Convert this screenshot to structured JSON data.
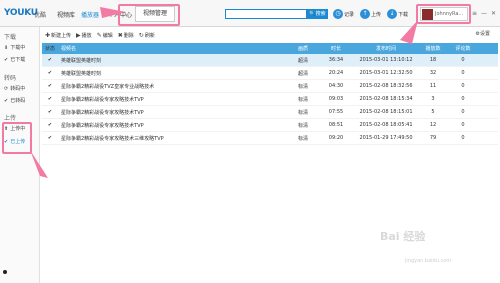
{
  "app": {
    "logo": "YOUKU",
    "logo_text": "优酷",
    "nav": [
      "视频库",
      "播放器",
      "个人中心",
      "视频管理"
    ],
    "active_nav": "视频管理",
    "search_placeholder": "",
    "search_button": "搜索",
    "actions": {
      "history": "记录",
      "upload": "上传",
      "download": "下载"
    },
    "user": "JohnnyRa...",
    "window_controls": {
      "menu": "≡",
      "minimize": "—",
      "close": "✕"
    }
  },
  "sidebar": {
    "groups": [
      {
        "label": "下载",
        "items": [
          {
            "label": "下载中",
            "icon": "down-arrow-icon"
          },
          {
            "label": "已下载",
            "icon": "check-icon"
          }
        ]
      },
      {
        "label": "转码",
        "items": [
          {
            "label": "转码中",
            "icon": "spinner-icon"
          },
          {
            "label": "已转码",
            "icon": "check-icon"
          }
        ]
      },
      {
        "label": "上传",
        "items": [
          {
            "label": "上传中",
            "icon": "up-arrow-icon"
          },
          {
            "label": "已上传",
            "icon": "check-icon",
            "selected": true
          }
        ]
      }
    ]
  },
  "toolbar": {
    "new_upload": "新建上传",
    "play": "播放",
    "edit": "编辑",
    "delete": "删除",
    "refresh": "刷新",
    "settings": "设置"
  },
  "table": {
    "headers": [
      "状态",
      "视频名",
      "画质",
      "时长",
      "发布时间",
      "播放数",
      "评论数"
    ],
    "rows": [
      {
        "status": "✔",
        "name": "英雄联盟英雄时刻",
        "quality": "超清",
        "duration": "36:34",
        "published": "2015-03-01 13:10:12",
        "plays": "18",
        "comments": "0",
        "selected": true
      },
      {
        "status": "✔",
        "name": "英雄联盟英雄时刻",
        "quality": "超清",
        "duration": "20:24",
        "published": "2015-03-01 12:32:50",
        "plays": "32",
        "comments": "0"
      },
      {
        "status": "✔",
        "name": "星际争霸2精彩战役TVZ皇家专业战略技术",
        "quality": "标清",
        "duration": "04:30",
        "published": "2015-02-08 18:32:56",
        "plays": "11",
        "comments": "0"
      },
      {
        "status": "✔",
        "name": "星际争霸2精彩战役专家攻略技术TVP",
        "quality": "标清",
        "duration": "09:03",
        "published": "2015-02-08 18:15:34",
        "plays": "3",
        "comments": "0"
      },
      {
        "status": "✔",
        "name": "星际争霸2精彩战役专家攻略技术TVP",
        "quality": "标清",
        "duration": "07:55",
        "published": "2015-02-08 18:15:01",
        "plays": "5",
        "comments": "0"
      },
      {
        "status": "✔",
        "name": "星际争霸2精彩战役专家攻略技术TVP",
        "quality": "标清",
        "duration": "08:51",
        "published": "2015-02-08 18:05:41",
        "plays": "12",
        "comments": "0"
      },
      {
        "status": "✔",
        "name": "星际争霸2精彩战役专家攻略技术三维攻略TVP",
        "quality": "标清",
        "duration": "09:20",
        "published": "2015-01-29 17:49:50",
        "plays": "79",
        "comments": "0"
      }
    ]
  },
  "watermark": {
    "main": "Bai 经验",
    "sub": "jingyan.baidu.com"
  },
  "colors": {
    "header": "#4aa7dd",
    "accent": "#1a8ad4",
    "annotation": "#f27aa3"
  }
}
